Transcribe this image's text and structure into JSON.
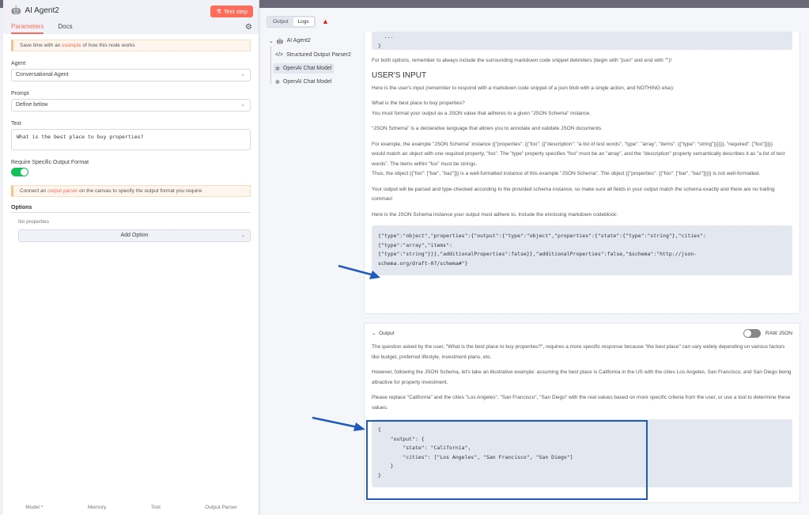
{
  "node": {
    "title": "AI Agent2",
    "test_step": "Test step",
    "tabs": [
      "Parameters",
      "Docs"
    ]
  },
  "params": {
    "notice1": {
      "pre": "Save time with an ",
      "link": "example",
      "post": " of how this node works"
    },
    "agent_label": "Agent",
    "agent_value": "Conversational Agent",
    "prompt_label": "Prompt",
    "prompt_value": "Define below",
    "text_label": "Text",
    "text_value": "What is the best place to buy properties?",
    "require_label": "Require Specific Output Format",
    "require_on": true,
    "notice2": {
      "pre": "Connect an ",
      "link": "output parser",
      "post": " on the canvas to specify the output format you require"
    },
    "options_label": "Options",
    "no_props": "No properties",
    "add_option": "Add Option"
  },
  "connectors": [
    "Model *",
    "Memory",
    "Tool",
    "Output Parser"
  ],
  "logs": {
    "tabs": [
      "Output",
      "Logs"
    ],
    "tree": [
      "AI Agent2",
      "Structured Output Parser2",
      "OpenAI Chat Model",
      "OpenAI Chat Model"
    ]
  },
  "input": {
    "code_top": "  ...\n}",
    "p_both": "For both options, remember to always include the surrounding markdown code snippet delimiters (begin with \"json\" and end with \"\")!",
    "heading": "USER'S INPUT",
    "p_here": "Here is the user's input (remember to respond with a markdown code snippet of a json blob with a single action, and NOTHING else):",
    "p_question": "What is the best place to buy properties?",
    "p_must": "You must format your output as a JSON value that adheres to a given \"JSON Schema\" instance.",
    "p_schema": "\"JSON Schema\" is a declarative language that allows you to annotate and validate JSON documents.",
    "p_example": "For example, the example \"JSON Schema\" instance {{\"properties\": {{\"foo\": {{\"description\": \"a list of test words\", \"type\": \"array\", \"items\": {{\"type\": \"string\"}}}}}}, \"required\": [\"foo\"]}}}}",
    "p_match": "would match an object with one required property, \"foo\". The \"type\" property specifies \"foo\" must be an \"array\", and the \"description\" property semantically describes it as \"a list of test words\". The items within \"foo\" must be strings.",
    "p_thus": "Thus, the object {{\"foo\": [\"bar\", \"baz\"]}} is a well-formatted instance of this example \"JSON Schema\". The object {{\"properties\": {{\"foo\": [\"bar\", \"baz\"]}}}} is not well-formatted.",
    "p_parsed": "Your output will be parsed and type-checked according to the provided schema instance, so make sure all fields in your output match the schema exactly and there are no trailing commas!",
    "p_instance": "Here is the JSON Schema instance your output must adhere to. Include the enclosing markdown codeblock:",
    "schema_code": "{\"type\":\"object\",\"properties\":{\"output\":{\"type\":\"object\",\"properties\":{\"state\":{\"type\":\"string\"},\"cities\":\n{\"type\":\"array\",\"items\":\n{\"type\":\"string\"}}},\"additionalProperties\":false}},\"additionalProperties\":false,\"$schema\":\"http://json-\nschema.org/draft-07/schema#\"}"
  },
  "output": {
    "label": "Output",
    "raw_json": "RAW JSON",
    "raw_on": false,
    "p1": "The question asked by the user, \"What is the best place to buy properties?\", requires a more specific response because \"the best place\" can vary widely depending on various factors like budget, preferred lifestyle, investment plans, etc.",
    "p2": "However, following the JSON Schema, let's take an illustrative example: assuming the best place is California in the US with the cities Los Angeles, San Francisco, and San Diego being attractive for property investment.",
    "p3": "Please replace \"California\" and the cities \"Los Angeles\", \"San Francisco\", \"San Diego\" with the real values based on more specific criteria from the user, or use a tool to determine these values.",
    "code": "{\n    \"output\": {\n        \"state\": \"California\",\n        \"cities\": [\"Los Angeles\", \"San Francisco\", \"San Diego\"]\n    }\n}"
  },
  "colors": {
    "accent": "#ff6d5a",
    "toggle_on": "#13c05a",
    "annotation": "#1f5bbf"
  }
}
